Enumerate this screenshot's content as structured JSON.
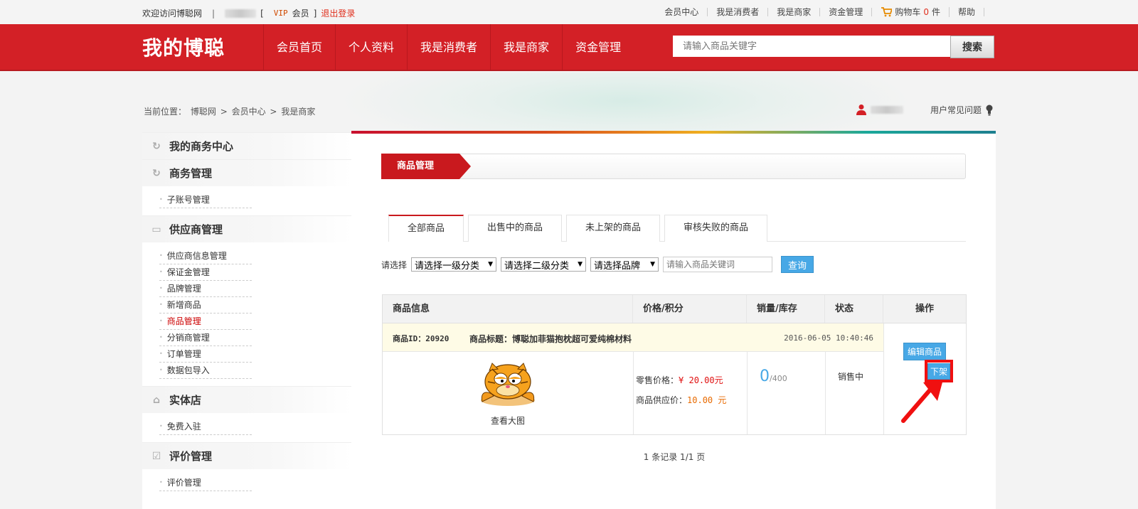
{
  "topbar": {
    "welcome": "欢迎访问博聪网",
    "divider": "|",
    "bracket_open": "[",
    "vip": "VIP",
    "member": "会员",
    "bracket_close": "]",
    "logout": "退出登录",
    "links": [
      "会员中心",
      "我是消费者",
      "我是商家",
      "资金管理"
    ],
    "cart_label": "购物车",
    "cart_count": "0",
    "cart_unit": "件",
    "help": "帮助"
  },
  "header": {
    "logo": "我的博聪",
    "nav": [
      "会员首页",
      "个人资料",
      "我是消费者",
      "我是商家",
      "资金管理"
    ],
    "search_placeholder": "请输入商品关键字",
    "search_button": "搜索"
  },
  "breadcrumb": {
    "prefix": "当前位置：",
    "items": [
      "博聪网",
      "会员中心",
      "我是商家"
    ],
    "sep": ">"
  },
  "faq": "用户常见问题",
  "sidebar": {
    "section_center": "我的商务中心",
    "section_business": "商务管理",
    "business_items": [
      "子账号管理"
    ],
    "section_supplier": "供应商管理",
    "supplier_items": [
      "供应商信息管理",
      "保证金管理",
      "品牌管理",
      "新增商品",
      "商品管理",
      "分销商管理",
      "订单管理",
      "数据包导入"
    ],
    "section_store": "实体店",
    "store_items": [
      "免费入驻"
    ],
    "section_review": "评价管理",
    "review_items": [
      "评价管理"
    ]
  },
  "main": {
    "title": "商品管理",
    "tabs": [
      "全部商品",
      "出售中的商品",
      "未上架的商品",
      "审核失败的商品"
    ],
    "filter": {
      "label": "请选择",
      "select1": "请选择一级分类",
      "select2": "请选择二级分类",
      "select3": "请选择品牌",
      "keyword_placeholder": "请输入商品关键词",
      "query": "查询"
    },
    "table": {
      "headers": [
        "商品信息",
        "价格/积分",
        "销量/库存",
        "状态",
        "操作"
      ],
      "rows": [
        {
          "id_label": "商品ID：20920",
          "title_label": "商品标题：博聪加菲猫抱枕超可爱纯棉材料",
          "date": "2016-06-05 10:40:46",
          "view_big": "查看大图",
          "retail_label": "零售价格：",
          "retail_price": "¥ 20.00元",
          "supply_label": "商品供应价：",
          "supply_price": "10.00 元",
          "sales": "0",
          "stock": "/400",
          "status": "销售中",
          "edit": "编辑商品",
          "off_shelf": "下架"
        }
      ]
    },
    "pager": "1 条记录 1/1 页"
  },
  "colors": {
    "brand_red": "#d32026",
    "accent_blue": "#47a8e6",
    "price_red": "#e01010",
    "price_orange": "#e86a00"
  }
}
